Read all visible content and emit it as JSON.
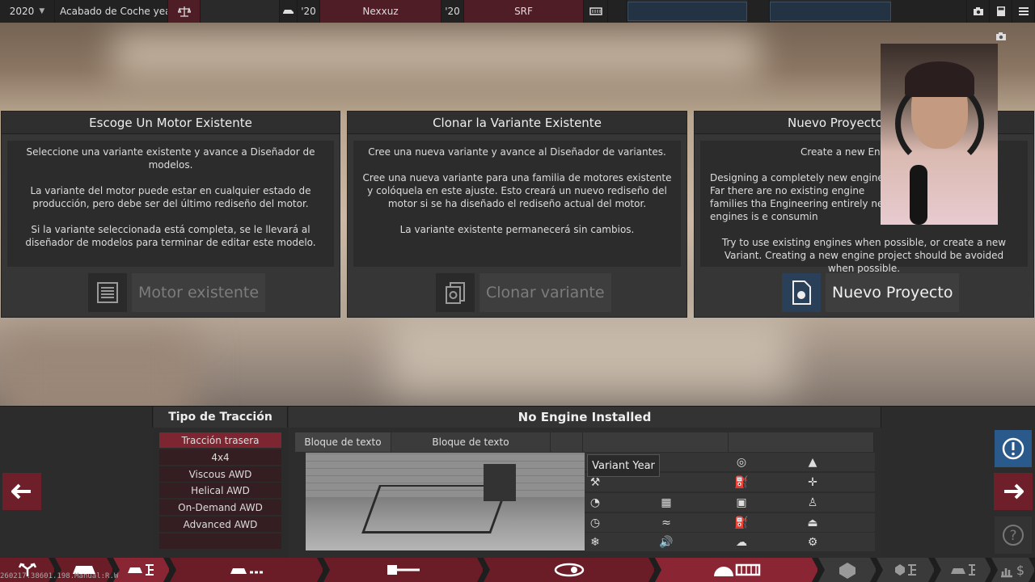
{
  "topbar": {
    "year": "2020",
    "trim_label": "Acabado de Coche year",
    "model_year": "'20",
    "model_name": "Nexxuz",
    "trim_year": "'20",
    "trim_name": "SRF"
  },
  "panels": [
    {
      "title": "Escoge Un Motor Existente",
      "paragraphs": [
        "Seleccione una variante existente y avance a Diseñador de modelos.",
        "La variante del motor puede estar en cualquier estado de producción, pero debe ser del último rediseño del motor.",
        "Si la variante seleccionada está completa, se le llevará al diseñador de modelos para terminar de editar este modelo."
      ],
      "button": "Motor existente"
    },
    {
      "title": "Clonar la Variante Existente",
      "paragraphs": [
        "Cree una nueva variante y avance al Diseñador de variantes.",
        "Cree una nueva variante para una familia de motores existente y colóquela en este ajuste. Esto creará un nuevo rediseño del motor si se ha diseñado el rediseño actual del motor.",
        "La variante existente permanecerá sin cambios."
      ],
      "button": "Clonar variante"
    },
    {
      "title": "Nuevo Proyecto",
      "paragraphs": [
        "Create a new Engi",
        "Designing a completely new engine Far there are no existing engine families tha Engineering entirely new engines is e consumin",
        "Try to use existing engines when possible, or create a new Variant. Creating a new engine project should be avoided when possible."
      ],
      "button": "Nuevo Proyecto"
    }
  ],
  "traction": {
    "title": "Tipo de Tracción",
    "items": [
      "Tracción trasera",
      "4x4",
      "Viscous AWD",
      "Helical AWD",
      "On-Demand AWD",
      "Advanced AWD"
    ],
    "selected": "Tracción trasera"
  },
  "engine": {
    "title": "No Engine Installed",
    "tabs": [
      "Bloque de texto",
      "Bloque de texto"
    ],
    "tooltip": "Variant Year"
  },
  "build_id": "260217.38601.198.Manual:R.W",
  "colors": {
    "accent_red": "#7d2631",
    "accent_blue": "#2a4058"
  }
}
